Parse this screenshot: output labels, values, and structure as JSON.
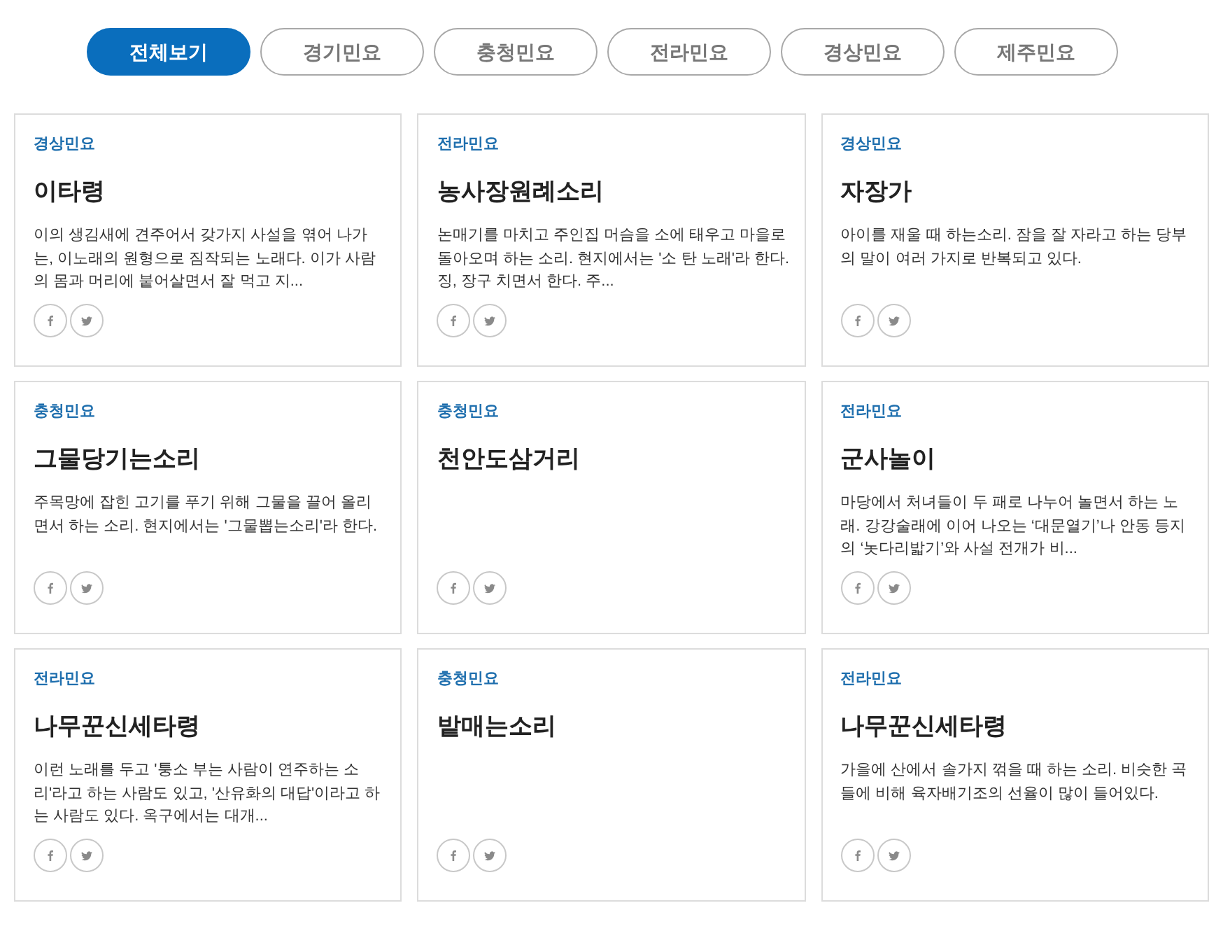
{
  "tabs": [
    {
      "label": "전체보기",
      "selected": true
    },
    {
      "label": "경기민요",
      "selected": false
    },
    {
      "label": "충청민요",
      "selected": false
    },
    {
      "label": "전라민요",
      "selected": false
    },
    {
      "label": "경상민요",
      "selected": false
    },
    {
      "label": "제주민요",
      "selected": false
    }
  ],
  "cards": [
    {
      "category": "경상민요",
      "title": "이타령",
      "description": "이의 생김새에 견주어서 갖가지 사설을 엮어 나가는, 이노래의 원형으로 짐작되는 노래다. 이가 사람의 몸과 머리에 붙어살면서 잘 먹고 지..."
    },
    {
      "category": "전라민요",
      "title": "농사장원례소리",
      "description": "논매기를 마치고 주인집 머슴을 소에 태우고 마을로 돌아오며 하는 소리. 현지에서는 '소 탄 노래'라 한다. 징, 장구 치면서 한다. 주..."
    },
    {
      "category": "경상민요",
      "title": "자장가",
      "description": "아이를 재울 때 하는소리. 잠을 잘 자라고 하는 당부의 말이 여러 가지로 반복되고 있다."
    },
    {
      "category": "충청민요",
      "title": "그물당기는소리",
      "description": "주목망에 잡힌 고기를 푸기 위해 그물을 끌어 올리면서 하는 소리. 현지에서는 '그물뽑는소리'라 한다."
    },
    {
      "category": "충청민요",
      "title": "천안도삼거리"
    },
    {
      "category": "전라민요",
      "title": "군사놀이",
      "description": "마당에서 처녀들이 두 패로 나누어 놀면서 하는 노래. 강강술래에 이어 나오는 ‘대문열기’나 안동 등지의 ‘놋다리밟기’와 사설 전개가 비..."
    },
    {
      "category": "전라민요",
      "title": "나무꾼신세타령",
      "description": "이런 노래를 두고 '퉁소 부는 사람이 연주하는 소리'라고 하는 사람도 있고, '산유화의 대답'이라고 하는 사람도 있다. 옥구에서는 대개..."
    },
    {
      "category": "충청민요",
      "title": "밭매는소리"
    },
    {
      "category": "전라민요",
      "title": "나무꾼신세타령",
      "description": "가을에 산에서 솔가지 꺾을 때 하는 소리. 비슷한 곡들에 비해 육자배기조의 선율이 많이 들어있다."
    }
  ]
}
